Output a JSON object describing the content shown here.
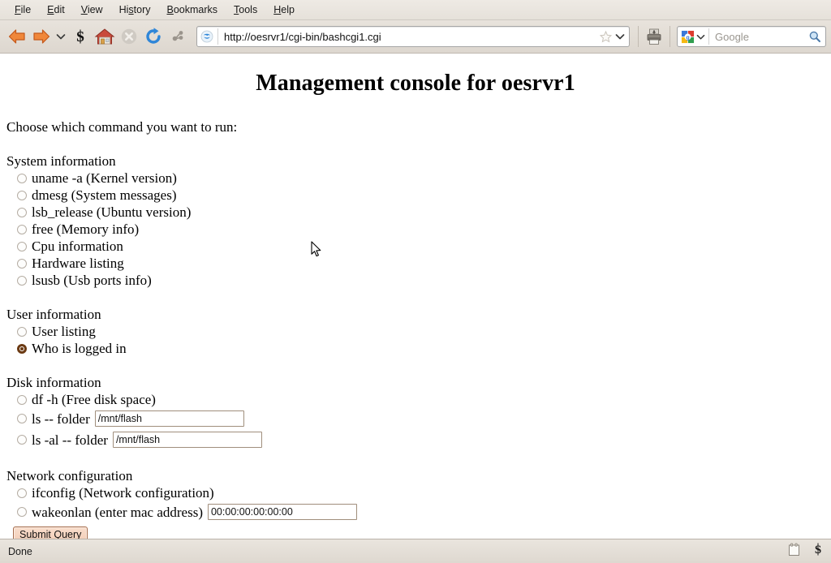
{
  "browser": {
    "menu": [
      {
        "pre": "",
        "acc": "F",
        "post": "ile"
      },
      {
        "pre": "",
        "acc": "E",
        "post": "dit"
      },
      {
        "pre": "",
        "acc": "V",
        "post": "iew"
      },
      {
        "pre": "Hi",
        "acc": "s",
        "post": "tory"
      },
      {
        "pre": "",
        "acc": "B",
        "post": "ookmarks"
      },
      {
        "pre": "",
        "acc": "T",
        "post": "ools"
      },
      {
        "pre": "",
        "acc": "H",
        "post": "elp"
      }
    ],
    "nav": {
      "back": "back-arrow-icon",
      "forward": "forward-arrow-icon",
      "history_dropdown": "chevron-down-icon",
      "brand": "s-logo-icon",
      "home": "home-icon",
      "stop": "stop-icon",
      "reload": "reload-icon",
      "share": "share-icon",
      "print": "printer-icon"
    },
    "url": "http://oesrvr1/cgi-bin/bashcgi1.cgi",
    "search_placeholder": "Google",
    "status": "Done",
    "status_icons": [
      "notes-icon",
      "s-logo-icon"
    ]
  },
  "page": {
    "title": "Management console for oesrvr1",
    "intro": "Choose which command you want to run:",
    "sections": [
      {
        "title": "System information",
        "options": [
          {
            "label": "uname -a (Kernel version)",
            "checked": false,
            "input": null
          },
          {
            "label": "dmesg (System messages)",
            "checked": false,
            "input": null
          },
          {
            "label": "lsb_release (Ubuntu version)",
            "checked": false,
            "input": null
          },
          {
            "label": "free (Memory info)",
            "checked": false,
            "input": null
          },
          {
            "label": "Cpu information",
            "checked": false,
            "input": null
          },
          {
            "label": "Hardware listing",
            "checked": false,
            "input": null
          },
          {
            "label": "lsusb (Usb ports info)",
            "checked": false,
            "input": null
          }
        ]
      },
      {
        "title": "User information",
        "options": [
          {
            "label": "User listing",
            "checked": false,
            "input": null
          },
          {
            "label": "Who is logged in",
            "checked": true,
            "input": null
          }
        ]
      },
      {
        "title": "Disk information",
        "options": [
          {
            "label": "df -h (Free disk space)",
            "checked": false,
            "input": null
          },
          {
            "label": "ls -- folder",
            "checked": false,
            "input": {
              "value": "/mnt/flash",
              "width_class": "w-folder"
            }
          },
          {
            "label": "ls -al -- folder",
            "checked": false,
            "input": {
              "value": "/mnt/flash",
              "width_class": "w-folder-al"
            }
          }
        ]
      },
      {
        "title": "Network configuration",
        "options": [
          {
            "label": "ifconfig (Network configuration)",
            "checked": false,
            "input": null
          },
          {
            "label": "wakeonlan (enter mac address)",
            "checked": false,
            "input": {
              "value": "00:00:00:00:00:00",
              "width_class": "w-mac"
            }
          }
        ]
      }
    ],
    "submit_label": "Submit Query"
  },
  "colors": {
    "chrome_bg": "#e6e1da",
    "radio_selected": "#6b3a13",
    "button_face": "#f3cdb6",
    "page_bg": "#ffffff"
  }
}
